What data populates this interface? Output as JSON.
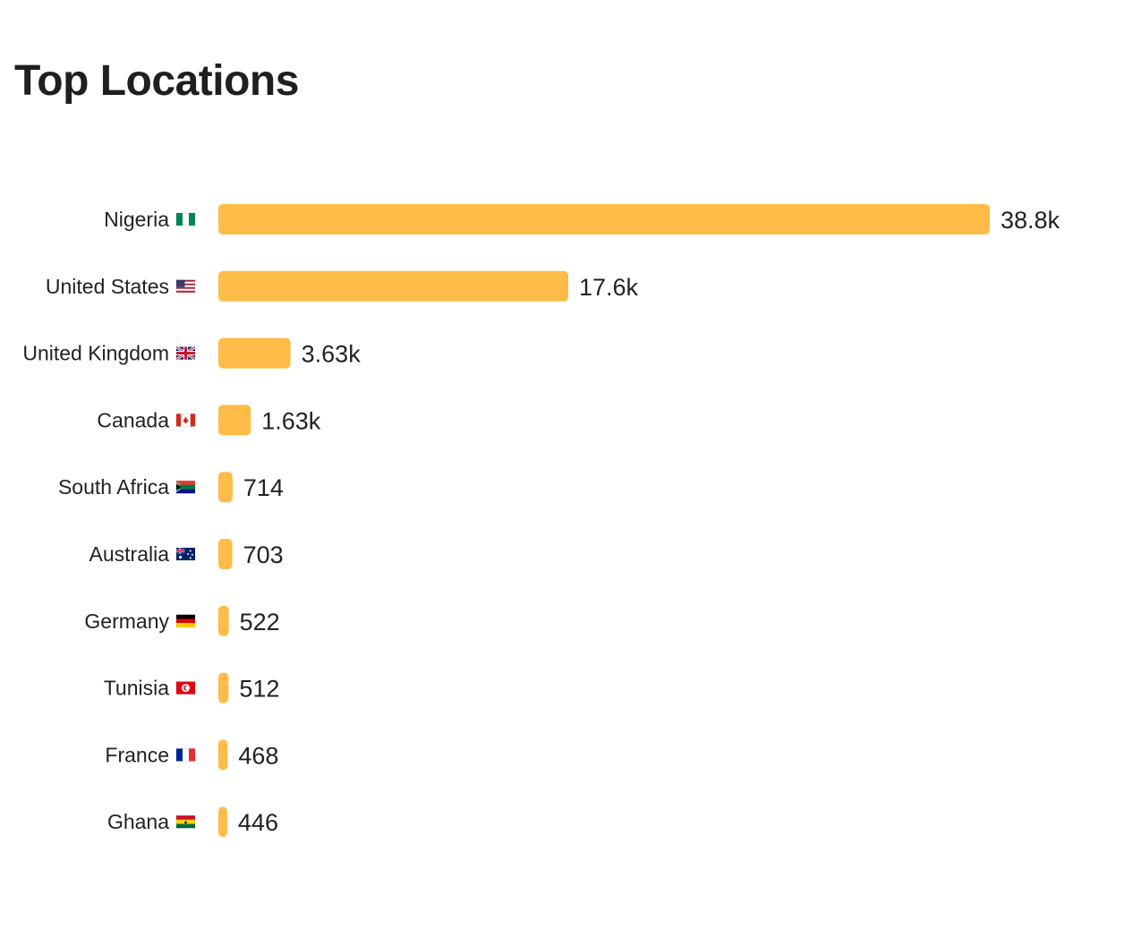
{
  "page": {
    "title": "Top Locations"
  },
  "chart_data": {
    "type": "bar",
    "orientation": "horizontal",
    "title": "Top Locations",
    "bar_color": "#FDBC48",
    "categories": [
      "Nigeria",
      "United States",
      "United Kingdom",
      "Canada",
      "South Africa",
      "Australia",
      "Germany",
      "Tunisia",
      "France",
      "Ghana"
    ],
    "flags": [
      "ng",
      "us",
      "gb",
      "ca",
      "za",
      "au",
      "de",
      "tn",
      "fr",
      "gh"
    ],
    "values": [
      38800,
      17600,
      3630,
      1630,
      714,
      703,
      522,
      512,
      468,
      446
    ],
    "value_labels": [
      "38.8k",
      "17.6k",
      "3.63k",
      "1.63k",
      "714",
      "703",
      "522",
      "512",
      "468",
      "446"
    ],
    "xlim": [
      0,
      38800
    ],
    "grid": false,
    "legend": "none"
  }
}
